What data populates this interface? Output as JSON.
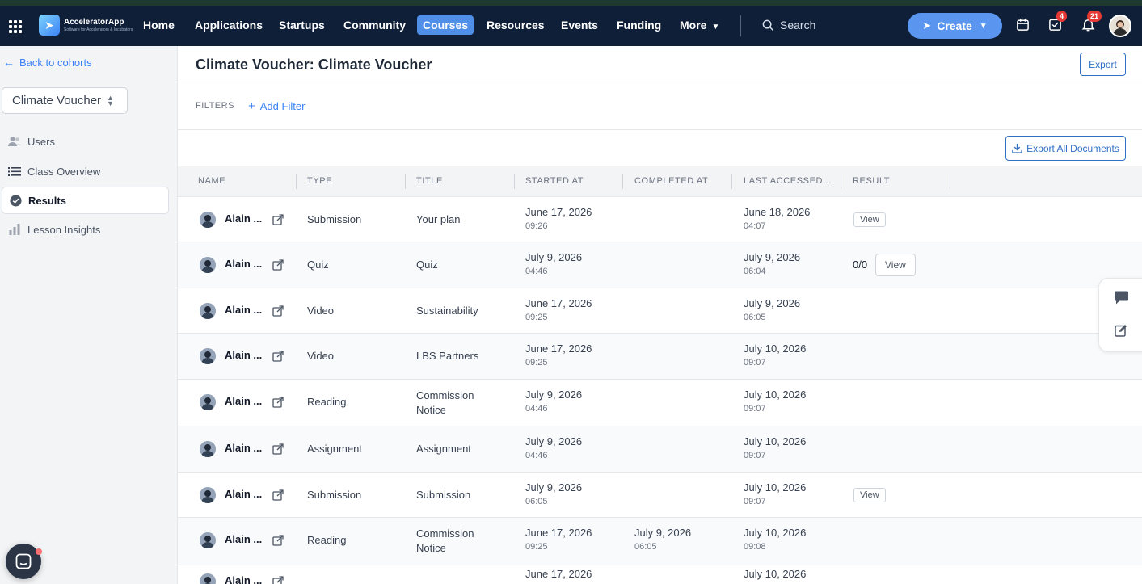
{
  "nav": {
    "brand_title": "AcceleratorApp",
    "brand_sub": "Software for Accelerators & Incubators",
    "items": [
      "Home",
      "Applications",
      "Startups",
      "Community",
      "Courses",
      "Resources",
      "Events",
      "Funding",
      "More"
    ],
    "active": "Courses",
    "search_label": "Search",
    "create_label": "Create",
    "tasks_badge": "4",
    "notifications_badge": "21"
  },
  "sidebar": {
    "back_label": "Back to cohorts",
    "cohort": "Climate Voucher",
    "items": [
      {
        "label": "Users",
        "icon": "users-icon"
      },
      {
        "label": "Class Overview",
        "icon": "list-icon"
      },
      {
        "label": "Results",
        "icon": "check-circle-icon"
      },
      {
        "label": "Lesson Insights",
        "icon": "bar-chart-icon"
      }
    ],
    "active": "Results"
  },
  "main": {
    "title": "Climate Voucher: Climate Voucher",
    "export_label": "Export",
    "filters_label": "FILTERS",
    "add_filter_label": "Add Filter",
    "export_all_label": "Export All Documents"
  },
  "table": {
    "columns": [
      "NAME",
      "TYPE",
      "TITLE",
      "STARTED AT",
      "COMPLETED AT",
      "LAST ACCESSED...",
      "RESULT"
    ],
    "view_label": "View",
    "rows": [
      {
        "name": "Alain ...",
        "type": "Submission",
        "title": "Your plan",
        "started_date": "June 17, 2026",
        "started_time": "09:26",
        "completed_date": "",
        "completed_time": "",
        "accessed_date": "June 18, 2026",
        "accessed_time": "04:07",
        "score": "",
        "view": true
      },
      {
        "name": "Alain ...",
        "type": "Quiz",
        "title": "Quiz",
        "started_date": "July 9, 2026",
        "started_time": "04:46",
        "completed_date": "",
        "completed_time": "",
        "accessed_date": "July 9, 2026",
        "accessed_time": "06:04",
        "score": "0/0",
        "view": true
      },
      {
        "name": "Alain ...",
        "type": "Video",
        "title": "Sustainability",
        "started_date": "June 17, 2026",
        "started_time": "09:25",
        "completed_date": "",
        "completed_time": "",
        "accessed_date": "July 9, 2026",
        "accessed_time": "06:05",
        "score": "",
        "view": false
      },
      {
        "name": "Alain ...",
        "type": "Video",
        "title": "LBS Partners",
        "started_date": "June 17, 2026",
        "started_time": "09:25",
        "completed_date": "",
        "completed_time": "",
        "accessed_date": "July 10, 2026",
        "accessed_time": "09:07",
        "score": "",
        "view": false
      },
      {
        "name": "Alain ...",
        "type": "Reading",
        "title": "Commission Notice",
        "started_date": "July 9, 2026",
        "started_time": "04:46",
        "completed_date": "",
        "completed_time": "",
        "accessed_date": "July 10, 2026",
        "accessed_time": "09:07",
        "score": "",
        "view": false
      },
      {
        "name": "Alain ...",
        "type": "Assignment",
        "title": "Assignment",
        "started_date": "July 9, 2026",
        "started_time": "04:46",
        "completed_date": "",
        "completed_time": "",
        "accessed_date": "July 10, 2026",
        "accessed_time": "09:07",
        "score": "",
        "view": false
      },
      {
        "name": "Alain ...",
        "type": "Submission",
        "title": "Submission",
        "started_date": "July 9, 2026",
        "started_time": "06:05",
        "completed_date": "",
        "completed_time": "",
        "accessed_date": "July 10, 2026",
        "accessed_time": "09:07",
        "score": "",
        "view": true
      },
      {
        "name": "Alain ...",
        "type": "Reading",
        "title": "Commission Notice",
        "started_date": "June 17, 2026",
        "started_time": "09:25",
        "completed_date": "July 9, 2026",
        "completed_time": "06:05",
        "accessed_date": "July 10, 2026",
        "accessed_time": "09:08",
        "score": "",
        "view": false
      },
      {
        "name": "Alain ...",
        "type": "",
        "title": "",
        "started_date": "June 17, 2026",
        "started_time": "",
        "completed_date": "",
        "completed_time": "",
        "accessed_date": "July 10, 2026",
        "accessed_time": "",
        "score": "",
        "view": false
      }
    ]
  }
}
